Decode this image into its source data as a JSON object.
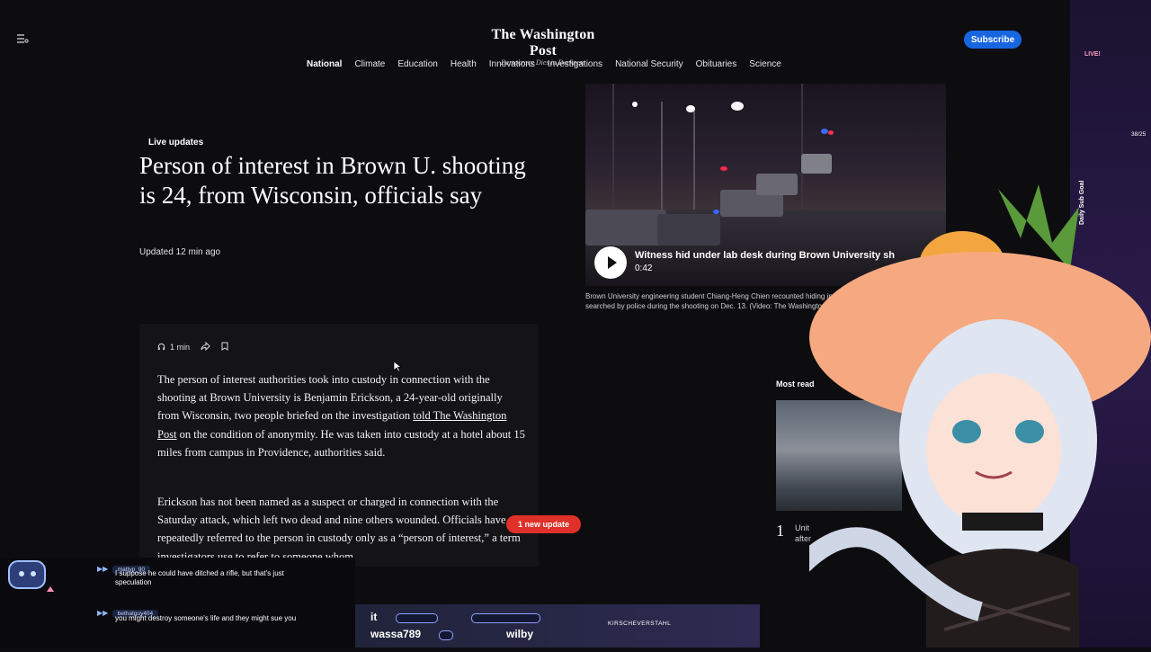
{
  "header": {
    "brand_name": "The Washington Post",
    "brand_tagline": "Democracy Dies in Darkness",
    "subscribe_label": "Subscribe",
    "nav": [
      "National",
      "Climate",
      "Education",
      "Health",
      "Innovations",
      "Investigations",
      "National Security",
      "Obituaries",
      "Science"
    ],
    "nav_active": "National"
  },
  "article": {
    "label": "Live updates",
    "headline": "Person of interest in Brown U. shooting is 24, from Wisconsin, officials say",
    "updated": "Updated 12 min ago",
    "listen_time": "1 min",
    "para1_a": "The person of interest authorities took into custody in connection with the shooting at Brown University is Benjamin Erickson, a 24-year-old originally from Wisconsin, two people briefed on the investigation ",
    "para1_link": "told The Washington Post",
    "para1_b": " on the condition of anonymity. He was taken into custody at a hotel about 15 miles from campus in Providence, authorities said.",
    "para2": "Erickson has not been named as a suspect or charged in connection with the Saturday attack, which left two dead and nine others wounded. Officials have repeatedly referred to the person in custody only as a “person of interest,” a term investigators use to refer to someone whom",
    "update_pill": "1 new update"
  },
  "video": {
    "title": "Witness hid under lab desk during Brown University sh",
    "duration": "0:42",
    "caption_line1": "Brown University engineering student Chiang-Heng Chien recounted hiding in the campus",
    "caption_line2": "searched by police during the shooting on Dec. 13. (Video: The Washington Post)"
  },
  "most_read": {
    "label": "Most read",
    "rank": "1",
    "line1": "Unit",
    "line2": "after"
  },
  "stream": {
    "chat": [
      {
        "user": "mattyp_90",
        "msg": "I suppose he could have ditched a rifle, but that's just speculation"
      },
      {
        "user": "bethatguy404",
        "msg": "you might destroy someone's life and they might sue you"
      }
    ],
    "bottom_names": [
      "it",
      "wassa789",
      "wilby"
    ],
    "ticker": "KIRSCHEVERSTAHL",
    "live_badge": "LIVE!",
    "sub_goal": "Daily Sub Goal",
    "sub_count": "38/25"
  },
  "colors": {
    "accent": "#1766e0",
    "alert": "#e0302a",
    "background": "#0d0d10"
  }
}
